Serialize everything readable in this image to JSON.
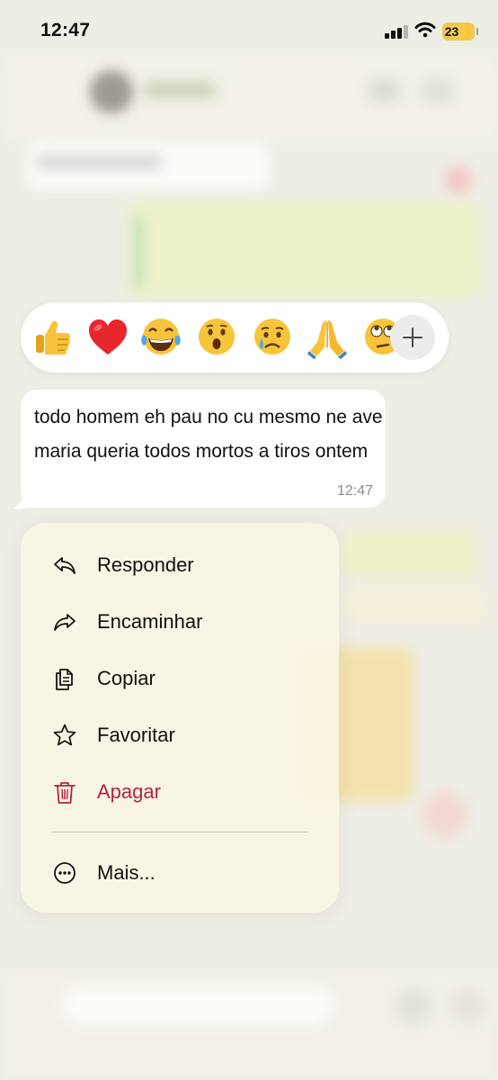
{
  "status_bar": {
    "time": "12:47",
    "battery": "23"
  },
  "reactions": {
    "emojis": [
      "👍",
      "❤️",
      "😂",
      "😮",
      "😢",
      "🙏",
      "🙄"
    ],
    "add_icon": "plus-icon"
  },
  "message": {
    "text": "todo homem eh pau no cu mesmo ne ave maria queria todos mortos a tiros ontem",
    "time": "12:47"
  },
  "menu": {
    "items": [
      {
        "label": "Responder",
        "icon": "reply-icon"
      },
      {
        "label": "Encaminhar",
        "icon": "forward-icon"
      },
      {
        "label": "Copiar",
        "icon": "copy-icon"
      },
      {
        "label": "Favoritar",
        "icon": "star-icon"
      },
      {
        "label": "Apagar",
        "icon": "trash-icon"
      },
      {
        "label": "Mais...",
        "icon": "more-icon"
      }
    ]
  },
  "colors": {
    "danger": "#b3243b",
    "menu_bg": "#faf5e4"
  }
}
